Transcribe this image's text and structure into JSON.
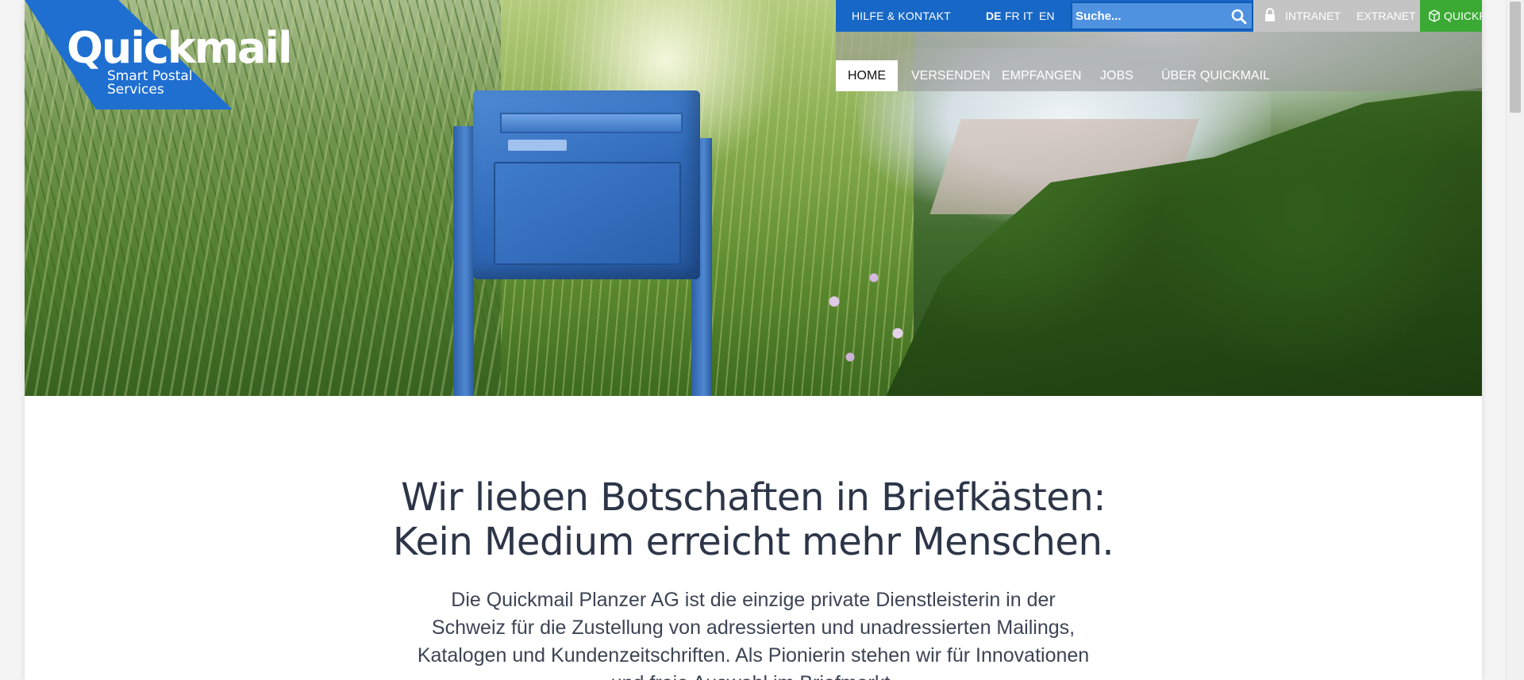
{
  "brand": {
    "name": "Quickmail",
    "tagline": "Smart Postal Services",
    "primary_color": "#1767c6",
    "accent_green": "#3aaa35"
  },
  "topbar": {
    "help_label": "HILFE & KONTAKT",
    "languages": [
      "DE",
      "FR",
      "IT",
      "EN"
    ],
    "active_language": "DE",
    "search_placeholder": "Suche...",
    "intranet_label": "INTRANET",
    "extranet_label": "EXTRANET",
    "quickpac_label": "QUICKPAC"
  },
  "nav": {
    "items": [
      {
        "label": "HOME",
        "active": true
      },
      {
        "label": "VERSENDEN",
        "active": false
      },
      {
        "label": "EMPFANGEN",
        "active": false
      },
      {
        "label": "JOBS",
        "active": false
      },
      {
        "label": "ÜBER QUICKMAIL",
        "active": false
      }
    ]
  },
  "main": {
    "headline_line1": "Wir lieben Botschaften in Briefkästen:",
    "headline_line2": "Kein Medium erreicht mehr Menschen.",
    "intro": "Die Quickmail Planzer AG ist die einzige private Dienstleisterin in der Schweiz für die Zustellung von adressierten und unadressierten Mailings, Katalogen und Kundenzeitschriften. Als Pionierin stehen wir für Innovationen und freie Auswahl im Briefmarkt."
  },
  "icons": {
    "search": "search-icon",
    "lock": "lock-icon",
    "quickpac": "cube-icon"
  }
}
